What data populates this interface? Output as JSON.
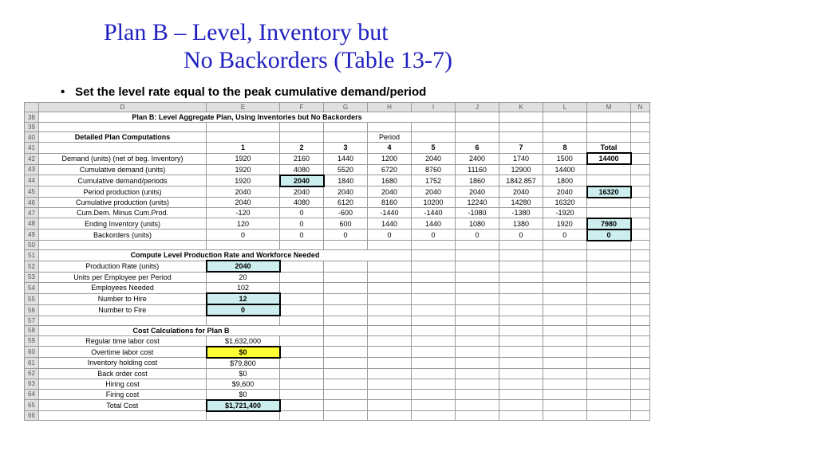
{
  "title_line1": "Plan B – Level, Inventory but",
  "title_line2": "No Backorders (Table 13-7)",
  "bullet": "Set the level rate equal to the peak cumulative demand/period",
  "cols": [
    "D",
    "E",
    "F",
    "G",
    "H",
    "I",
    "J",
    "K",
    "L",
    "M",
    "N"
  ],
  "row38": {
    "n": "38",
    "d": "Plan B: Level Aggregate Plan, Using Inventories but No Backorders"
  },
  "row39": {
    "n": "39"
  },
  "row40": {
    "n": "40",
    "d": "Detailed Plan Computations",
    "period": "Period"
  },
  "row41": {
    "n": "41",
    "vals": [
      "1",
      "2",
      "3",
      "4",
      "5",
      "6",
      "7",
      "8"
    ],
    "total": "Total"
  },
  "rows_data": [
    {
      "n": "42",
      "label": "Demand (units) (net of beg. Inventory)",
      "v": [
        "1920",
        "2160",
        "1440",
        "1200",
        "2040",
        "2400",
        "1740",
        "1500"
      ],
      "total": "14400",
      "tstyle": "thick"
    },
    {
      "n": "43",
      "label": "Cumulative demand (units)",
      "v": [
        "1920",
        "4080",
        "5520",
        "6720",
        "8760",
        "11160",
        "12900",
        "14400"
      ],
      "total": ""
    },
    {
      "n": "44",
      "label": "Cumulative demand/periods",
      "v": [
        "1920",
        "2040",
        "1840",
        "1680",
        "1752",
        "1860",
        "1842.857",
        "1800"
      ],
      "total": "",
      "hi": [
        1
      ]
    },
    {
      "n": "45",
      "label": "Period production (units)",
      "v": [
        "2040",
        "2040",
        "2040",
        "2040",
        "2040",
        "2040",
        "2040",
        "2040"
      ],
      "total": "16320",
      "tstyle": "thick hcyan"
    },
    {
      "n": "46",
      "label": "Cumulative production (units)",
      "v": [
        "2040",
        "4080",
        "6120",
        "8160",
        "10200",
        "12240",
        "14280",
        "16320"
      ],
      "total": ""
    },
    {
      "n": "47",
      "label": "Cum.Dem. Minus Cum.Prod.",
      "v": [
        "-120",
        "0",
        "-600",
        "-1440",
        "-1440",
        "-1080",
        "-1380",
        "-1920"
      ],
      "total": ""
    },
    {
      "n": "48",
      "label": "Ending Inventory (units)",
      "v": [
        "120",
        "0",
        "600",
        "1440",
        "1440",
        "1080",
        "1380",
        "1920"
      ],
      "total": "7980",
      "tstyle": "thick hcyan"
    },
    {
      "n": "49",
      "label": "Backorders (units)",
      "v": [
        "0",
        "0",
        "0",
        "0",
        "0",
        "0",
        "0",
        "0"
      ],
      "total": "0",
      "tstyle": "thick hcyan"
    }
  ],
  "row50": {
    "n": "50"
  },
  "row51": {
    "n": "51",
    "d": "Compute Level Production Rate and Workforce Needed"
  },
  "workforce": [
    {
      "n": "52",
      "label": "Production Rate (units)",
      "val": "2040",
      "style": "thick hcyan"
    },
    {
      "n": "53",
      "label": "Units per Employee per Period",
      "val": "20",
      "style": ""
    },
    {
      "n": "54",
      "label": "Employees Needed",
      "val": "102",
      "style": ""
    },
    {
      "n": "55",
      "label": "Number to Hire",
      "val": "12",
      "style": "thick hcyan"
    },
    {
      "n": "56",
      "label": "Number to Fire",
      "val": "0",
      "style": "thick hcyan"
    }
  ],
  "row57": {
    "n": "57"
  },
  "row58": {
    "n": "58",
    "d": "Cost Calculations for Plan B"
  },
  "costs": [
    {
      "n": "59",
      "label": "Regular time labor cost",
      "val": "$1,632,000",
      "style": ""
    },
    {
      "n": "60",
      "label": "Overtime labor cost",
      "val": "$0",
      "style": "thick hyellow"
    },
    {
      "n": "61",
      "label": "Inventory holding cost",
      "val": "$79,800",
      "style": ""
    },
    {
      "n": "62",
      "label": "Back order cost",
      "val": "$0",
      "style": ""
    },
    {
      "n": "63",
      "label": "Hiring cost",
      "val": "$9,600",
      "style": ""
    },
    {
      "n": "64",
      "label": "Firing cost",
      "val": "$0",
      "style": ""
    },
    {
      "n": "65",
      "label": "Total Cost",
      "val": "$1,721,400",
      "style": "thick hcyan"
    }
  ],
  "row66": {
    "n": "66"
  }
}
